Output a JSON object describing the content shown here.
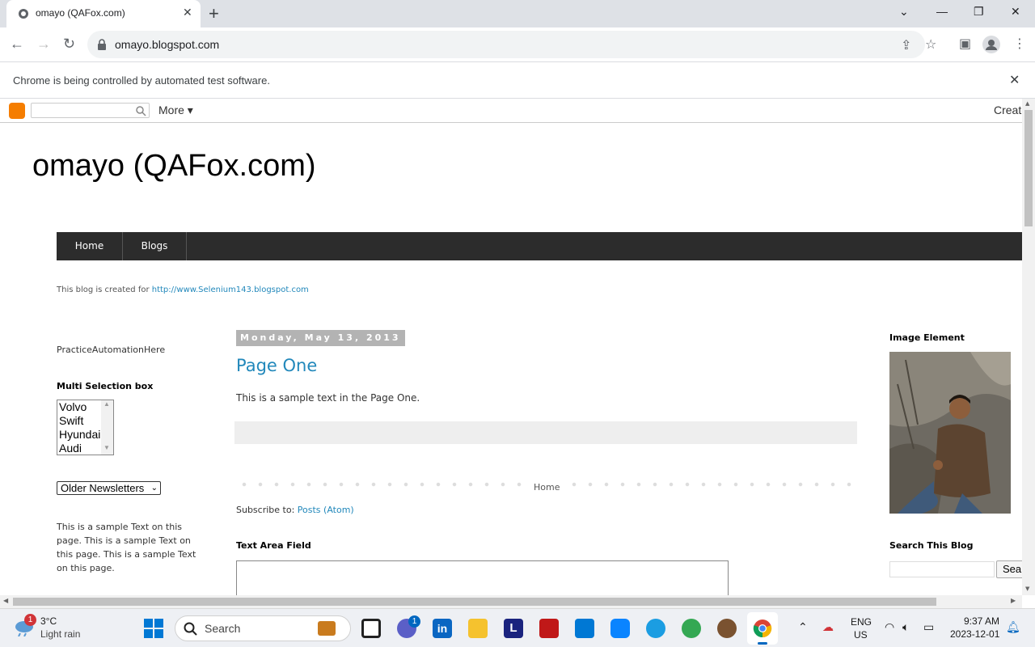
{
  "browser": {
    "tab_title": "omayo (QAFox.com)",
    "url": "omayo.blogspot.com",
    "infobar": "Chrome is being controlled by automated test software."
  },
  "blogger_navbar": {
    "more": "More",
    "create": "Create"
  },
  "blog": {
    "title": "omayo (QAFox.com)",
    "tabs": [
      "Home",
      "Blogs"
    ],
    "description": "This blog is created for ",
    "description_link": "http://www.Selenium143.blogspot.com"
  },
  "left_sidebar": {
    "practice": "PracticeAutomationHere",
    "multi_heading": "Multi Selection box",
    "multi_options": [
      "Volvo",
      "Swift",
      "Hyundai",
      "Audi"
    ],
    "newsletter_selected": "Older Newsletters",
    "sample_text": "This is a sample Text on this page. This is a sample Text on this page. This is a sample Text on this page."
  },
  "main": {
    "date": "Monday, May 13, 2013",
    "post_title": "Page One",
    "post_text": "This is a sample text in the Page One.",
    "home_link": "Home",
    "subscribe_label": "Subscribe to: ",
    "subscribe_link": "Posts (Atom)",
    "textarea_heading": "Text Area Field"
  },
  "right_sidebar": {
    "image_heading": "Image Element",
    "search_heading": "Search This Blog",
    "search_button": "Sea"
  },
  "taskbar": {
    "weather_temp": "3°C",
    "weather_desc": "Light rain",
    "weather_badge": "1",
    "search_label": "Search",
    "teams_badge": "1",
    "lang_top": "ENG",
    "lang_bottom": "US",
    "time": "9:37 AM",
    "date": "2023-12-01"
  }
}
